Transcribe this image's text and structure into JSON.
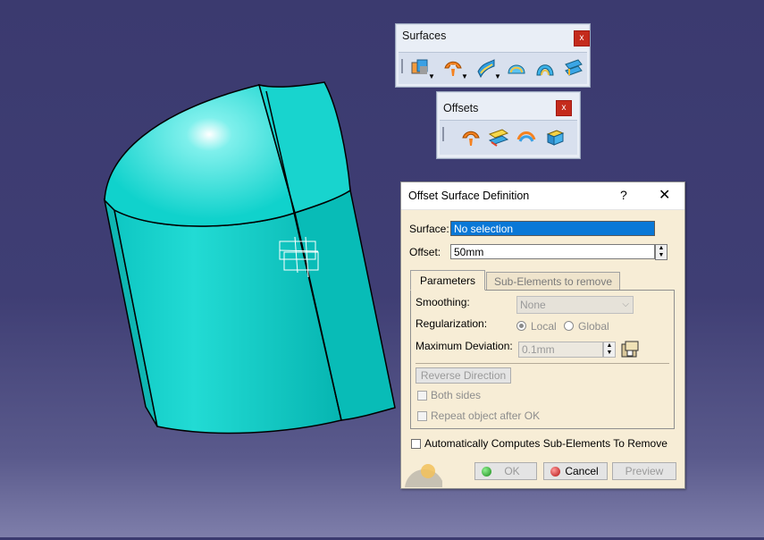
{
  "toolbars": {
    "surfaces": {
      "title": "Surfaces",
      "close": "x",
      "icons": [
        "extrude-surface-icon",
        "offset-surface-icon",
        "sweep-surface-icon",
        "fill-surface-icon",
        "multi-section-surface-icon",
        "blend-surface-icon"
      ]
    },
    "offsets": {
      "title": "Offsets",
      "close": "x",
      "icons": [
        "offset-icon",
        "variable-offset-icon",
        "rough-offset-icon",
        "thick-surface-icon"
      ]
    }
  },
  "dialog": {
    "title": "Offset Surface Definition",
    "help": "?",
    "close": "✕",
    "surface_label": "Surface:",
    "surface_value": "No selection",
    "offset_label": "Offset:",
    "offset_value": "50mm",
    "tabs": [
      "Parameters",
      "Sub-Elements to remove"
    ],
    "smoothing_label": "Smoothing:",
    "smoothing_value": "None",
    "regularization_label": "Regularization:",
    "regularization_options": [
      "Local",
      "Global"
    ],
    "regularization_selected": "Local",
    "max_deviation_label": "Maximum Deviation:",
    "max_deviation_value": "0.1mm",
    "reverse_direction": "Reverse Direction",
    "both_sides": "Both sides",
    "repeat_object": "Repeat object after OK",
    "auto_compute": "Automatically Computes Sub-Elements To Remove",
    "ok": "OK",
    "cancel": "Cancel",
    "preview": "Preview"
  },
  "colors": {
    "background": "#3f3e74",
    "surface": "#1fd6d0",
    "dialog_bg": "#f7edd6",
    "selection": "#0a78d7"
  }
}
